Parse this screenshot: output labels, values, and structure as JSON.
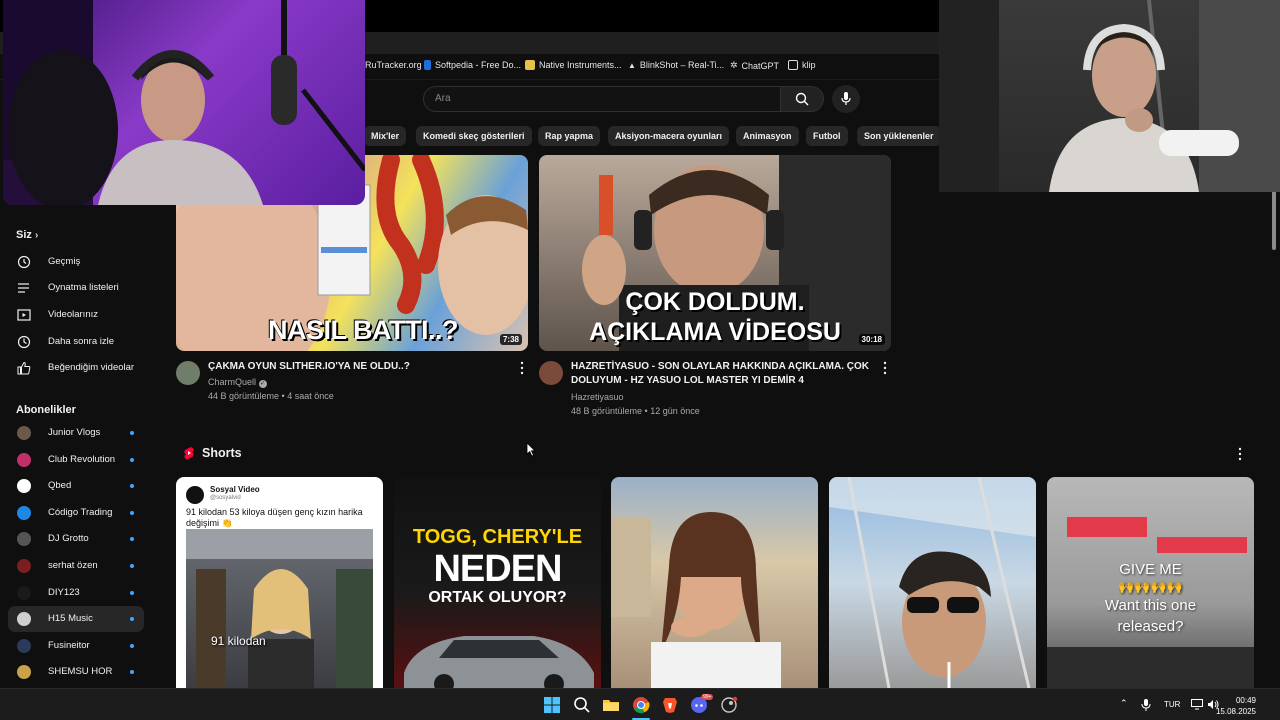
{
  "bookmarks": [
    {
      "label": "RuTracker.org",
      "icon": "rutracker-icon"
    },
    {
      "label": "Softpedia - Free Do...",
      "icon": "softpedia-icon"
    },
    {
      "label": "Native Instruments...",
      "icon": "folder-icon"
    },
    {
      "label": "BlinkShot – Real-Ti...",
      "icon": "triangle-icon"
    },
    {
      "label": "ChatGPT",
      "icon": "chatgpt-icon"
    },
    {
      "label": "klip",
      "icon": "folder-icon"
    }
  ],
  "search": {
    "placeholder": "Ara"
  },
  "chips": [
    "Mix'ler",
    "Komedi skeç gösterileri",
    "Rap yapma",
    "Aksiyon-macera oyunları",
    "Animasyon",
    "Futbol",
    "Son yüklenenler"
  ],
  "sidebar": {
    "you_header": "Siz",
    "you_items": [
      {
        "label": "Geçmiş",
        "icon": "history-icon"
      },
      {
        "label": "Oynatma listeleri",
        "icon": "playlist-icon"
      },
      {
        "label": "Videolarınız",
        "icon": "your-videos-icon"
      },
      {
        "label": "Daha sonra izle",
        "icon": "watch-later-icon"
      },
      {
        "label": "Beğendiğim videolar",
        "icon": "like-icon"
      }
    ],
    "subs_header": "Abonelikler",
    "subscriptions": [
      {
        "label": "Junior Vlogs",
        "color": "#6b5a4a",
        "active": false
      },
      {
        "label": "Club Revolution",
        "color": "#c0306a",
        "active": false
      },
      {
        "label": "Qbed",
        "color": "#ffffff",
        "active": false
      },
      {
        "label": "Código Trading",
        "color": "#1e88e5",
        "active": false
      },
      {
        "label": "DJ Grotto",
        "color": "#555555",
        "active": false
      },
      {
        "label": "serhat özen",
        "color": "#7a1f1f",
        "active": false
      },
      {
        "label": "DIY123",
        "color": "#1a1a1a",
        "active": false
      },
      {
        "label": "H15 Music",
        "color": "#cfcfcf",
        "active": true
      },
      {
        "label": "Fusineitor",
        "color": "#2a3a5a",
        "active": false
      },
      {
        "label": "SHEMSU HOR",
        "color": "#c9a24a",
        "active": false
      }
    ]
  },
  "videos": [
    {
      "overlay": "NASIL BATTI..?",
      "duration": "7:38",
      "title_line1": "ÇAKMA OYUN SLITHER.IO'YA NE OLDU..?",
      "title_line2": "",
      "channel": "CharmQuell",
      "meta": "44 B görüntüleme • 4 saat önce"
    },
    {
      "overlay_line1": "ÇOK DOLDUM.",
      "overlay_line2": "AÇIKLAMA VİDEOSU",
      "duration": "30:18",
      "title_line1": "HAZRETİYASUO - SON OLAYLAR HAKKINDA AÇIKLAMA. ÇOK",
      "title_line2": "DOLUYUM -  HZ YASUO LOL MASTER YI DEMİR 4",
      "channel": "Hazretiyasuo",
      "meta": "48 B görüntüleme • 12 gün önce"
    }
  ],
  "shorts_header": "Shorts",
  "shorts": [
    {
      "account": "Sosyal Video",
      "handle": "@sosyalvid",
      "caption_line1": "91 kilodan 53 kiloya düşen genç kızın harika",
      "caption_line2": "değişimi 👏",
      "overlay": "91 kilodan"
    },
    {
      "overlay_line1": "TOGG, CHERY'LE",
      "overlay_line2": "NEDEN",
      "overlay_line3": "ORTAK OLUYOR?"
    },
    {},
    {},
    {
      "overlay_line1": "GIVE ME",
      "overlay_line2": "🙌🙌🙌🙌",
      "overlay_line3": "Want this one",
      "overlay_line4": "released?"
    }
  ],
  "taskbar": {
    "tray_lang": "TUR",
    "time": "00:49",
    "date": "15.08.2025",
    "badge": "99+"
  }
}
